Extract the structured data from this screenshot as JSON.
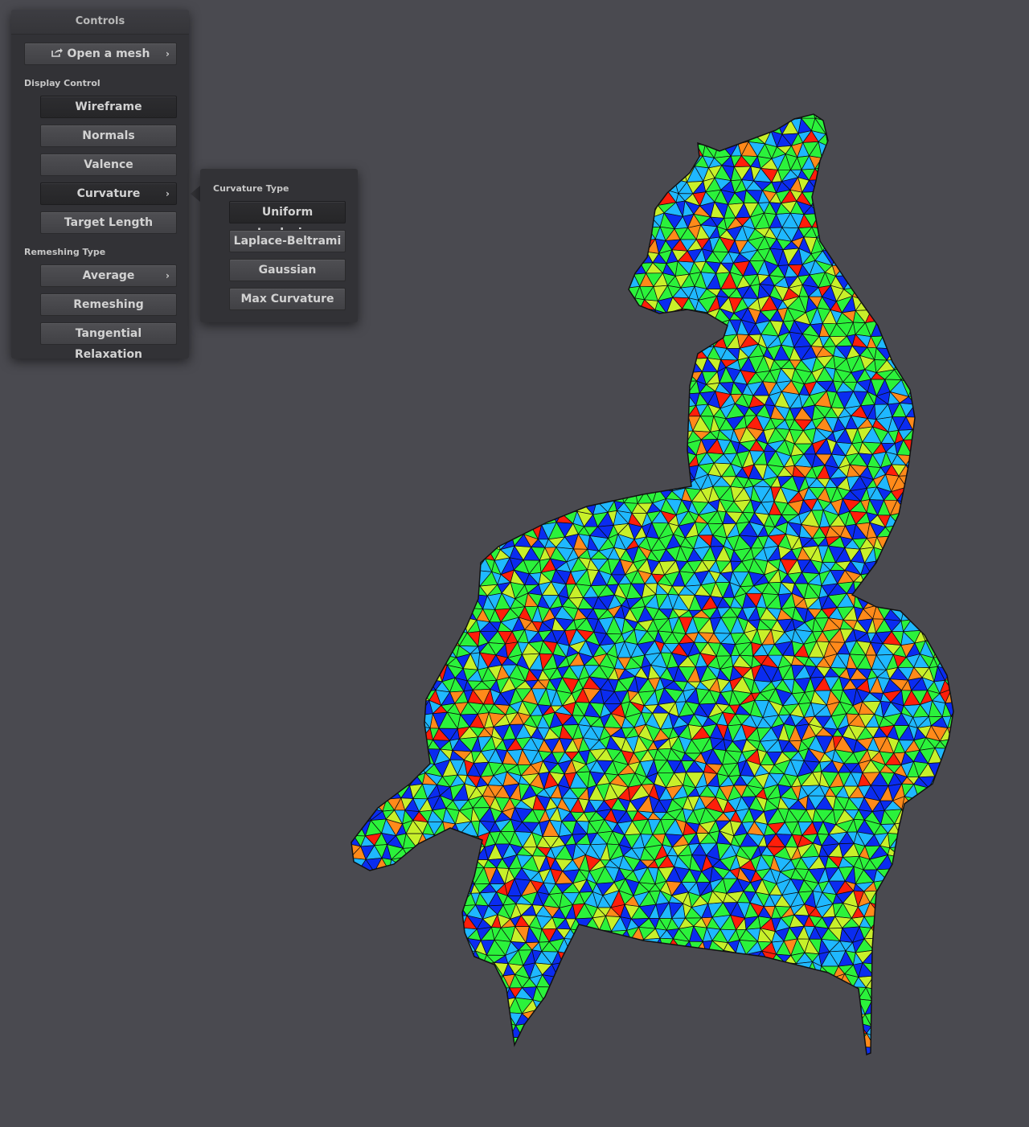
{
  "controls": {
    "title": "Controls",
    "open_mesh": {
      "label": "Open a mesh",
      "icon": "export-icon",
      "has_submenu": true
    },
    "display_control": {
      "label": "Display Control",
      "buttons": [
        {
          "label": "Wireframe",
          "active": true
        },
        {
          "label": "Normals",
          "active": false
        },
        {
          "label": "Valence",
          "active": false
        },
        {
          "label": "Curvature",
          "active": true,
          "has_submenu": true
        },
        {
          "label": "Target Length",
          "active": false
        }
      ]
    },
    "remeshing_type": {
      "label": "Remeshing Type",
      "buttons": [
        {
          "label": "Average",
          "has_submenu": true
        },
        {
          "label": "Remeshing"
        },
        {
          "label": "Tangential Relaxation"
        }
      ]
    }
  },
  "curvature_popup": {
    "label": "Curvature Type",
    "buttons": [
      {
        "label": "Uniform Laplacian",
        "active": true
      },
      {
        "label": "Laplace-Beltrami",
        "active": false
      },
      {
        "label": "Gaussian",
        "active": false
      },
      {
        "label": "Max Curvature",
        "active": false
      }
    ]
  },
  "viewport": {
    "background": "#4a4a50",
    "mesh": "cat statue wireframe with curvature coloring",
    "colormap": [
      "#0a2cf0",
      "#1fb8ff",
      "#2bf23b",
      "#c8f02a",
      "#ff8a1a",
      "#ff1e0a"
    ]
  },
  "icons": {
    "submenu": "chevron-right-icon"
  }
}
